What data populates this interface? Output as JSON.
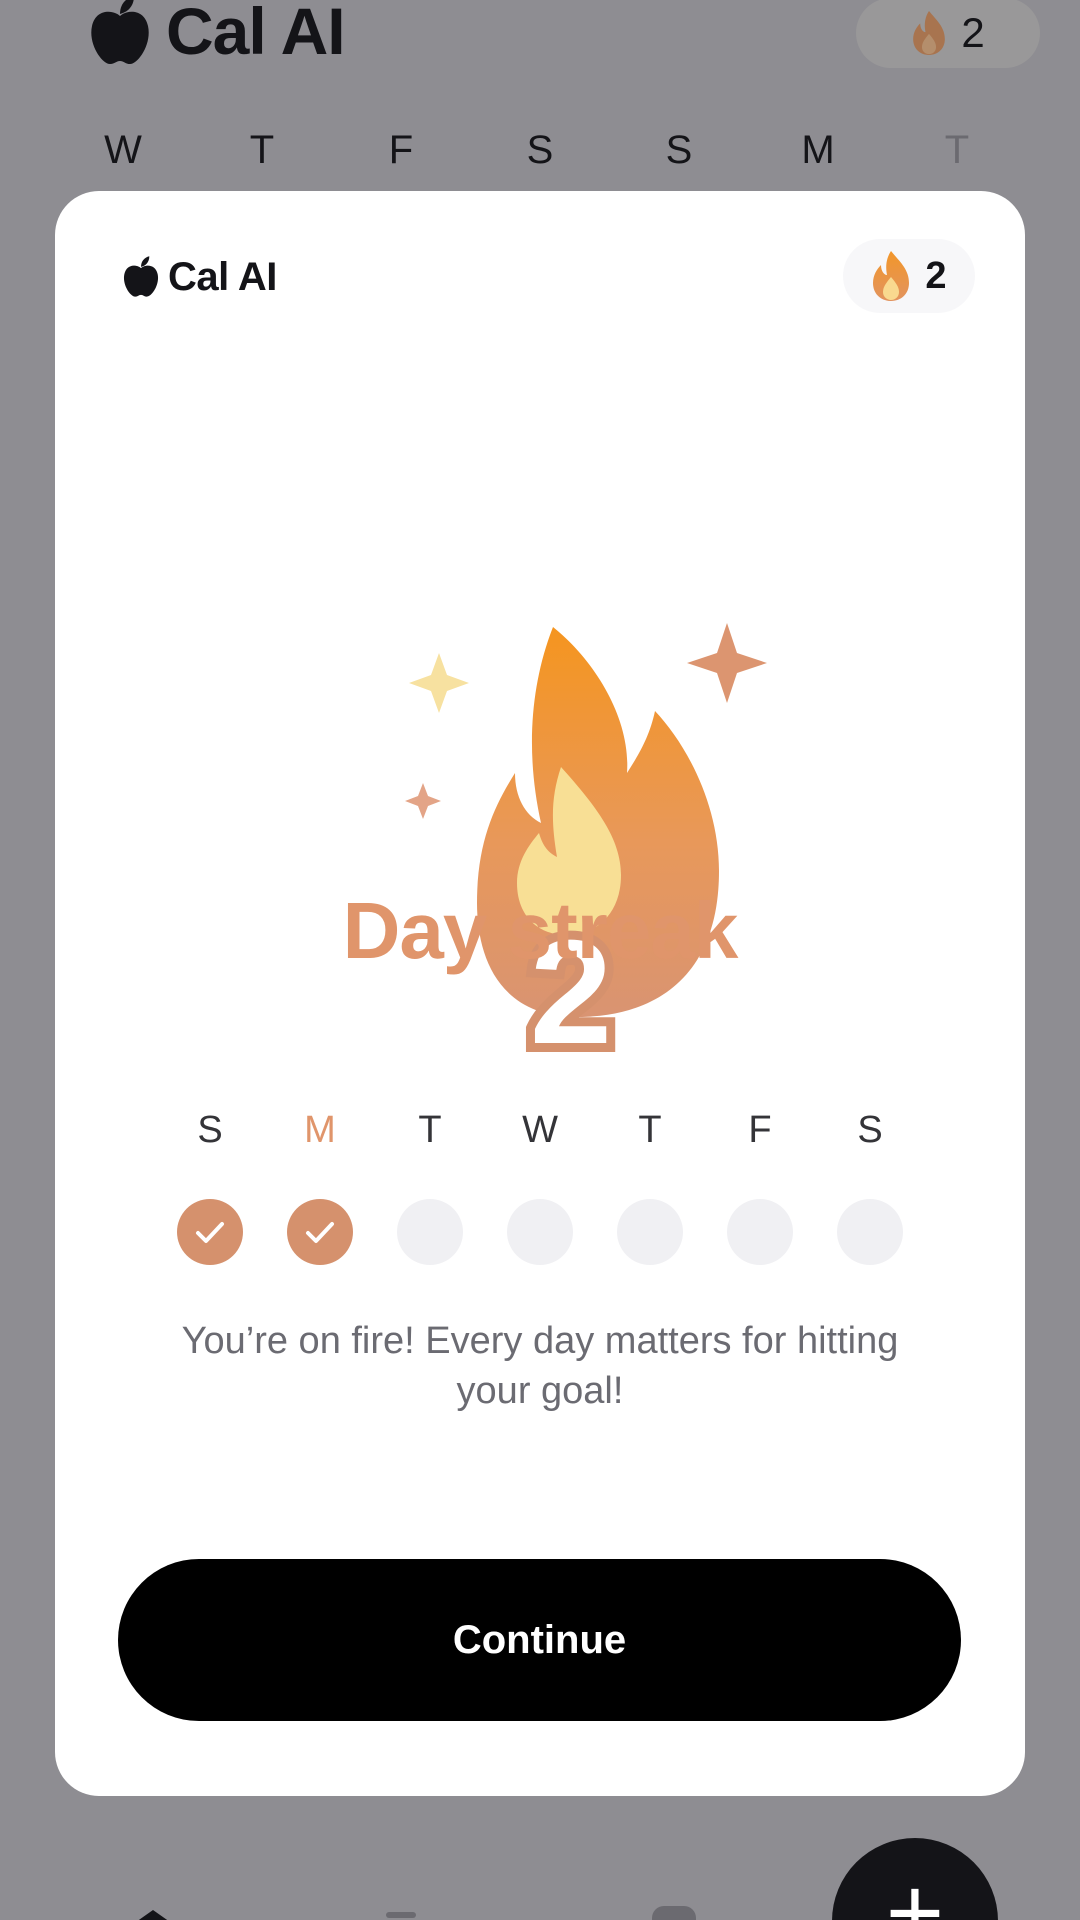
{
  "app": {
    "name": "Cal AI",
    "streak_count": "2"
  },
  "background": {
    "week_days": [
      "W",
      "T",
      "F",
      "S",
      "S",
      "M",
      "T"
    ],
    "fab_icon": "plus-icon"
  },
  "modal": {
    "brand_name": "Cal AI",
    "streak_badge_count": "2",
    "hero_number": "2",
    "title": "Day streak",
    "days": [
      {
        "label": "S",
        "completed": true,
        "today": false
      },
      {
        "label": "M",
        "completed": true,
        "today": true
      },
      {
        "label": "T",
        "completed": false,
        "today": false
      },
      {
        "label": "W",
        "completed": false,
        "today": false
      },
      {
        "label": "T",
        "completed": false,
        "today": false
      },
      {
        "label": "F",
        "completed": false,
        "today": false
      },
      {
        "label": "S",
        "completed": false,
        "today": false
      }
    ],
    "message": "You’re on fire! Every day matters for hitting your goal!",
    "continue_label": "Continue"
  },
  "colors": {
    "accent": "#e0956b",
    "checked_dot": "#d5916d",
    "button": "#000000"
  }
}
